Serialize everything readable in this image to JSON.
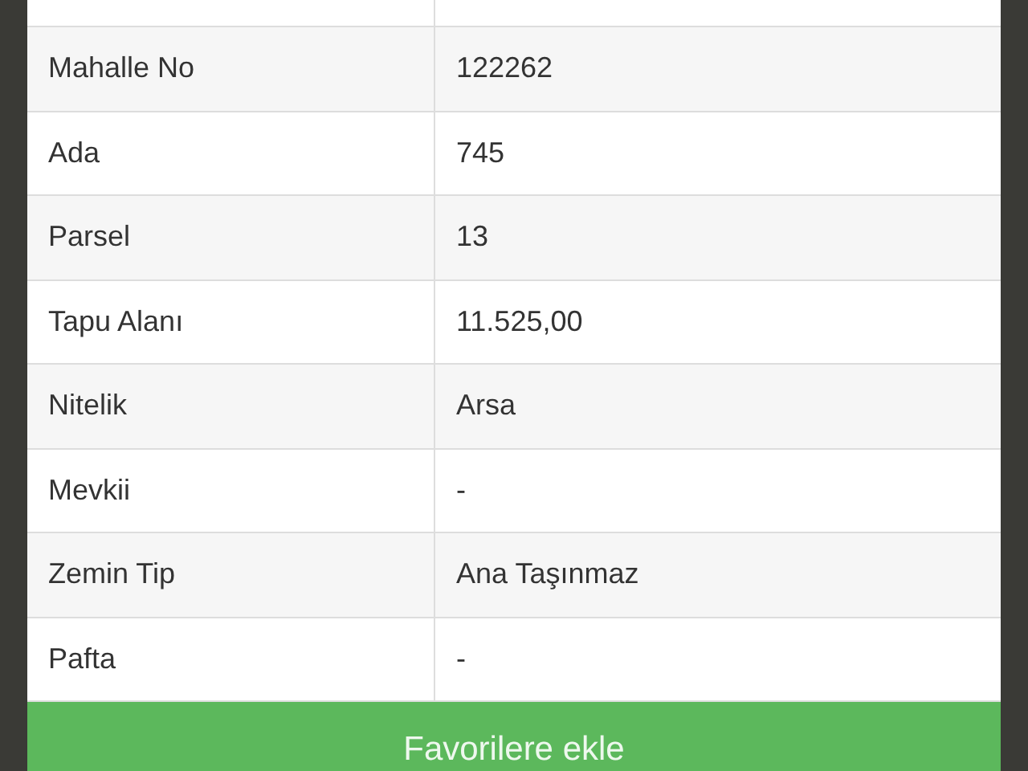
{
  "table": {
    "rows": [
      {
        "label": "Mahalle No",
        "value": "122262"
      },
      {
        "label": "Ada",
        "value": "745"
      },
      {
        "label": "Parsel",
        "value": "13"
      },
      {
        "label": "Tapu Alanı",
        "value": "11.525,00"
      },
      {
        "label": "Nitelik",
        "value": "Arsa"
      },
      {
        "label": "Mevkii",
        "value": "-"
      },
      {
        "label": "Zemin Tip",
        "value": "Ana Taşınmaz"
      },
      {
        "label": "Pafta",
        "value": "-"
      }
    ]
  },
  "button": {
    "label": "Favorilere ekle"
  }
}
